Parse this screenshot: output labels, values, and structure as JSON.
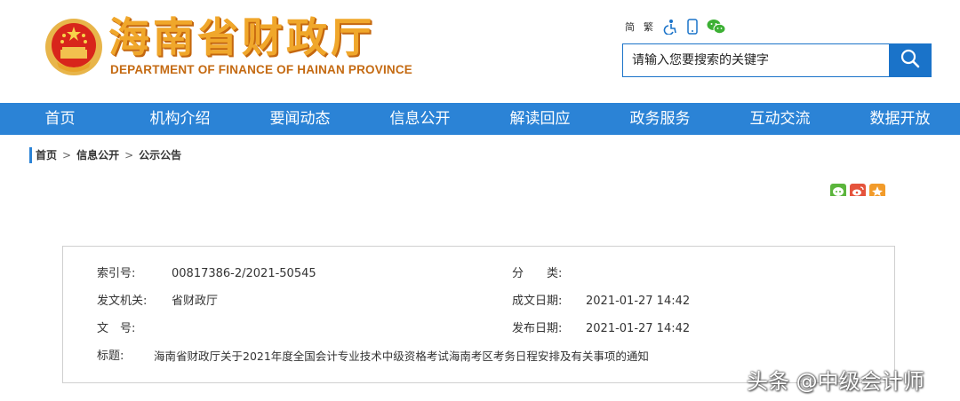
{
  "header": {
    "logo_cn": "海南省财政厅",
    "logo_en": "DEPARTMENT OF FINANCE OF HAINAN PROVINCE",
    "emblem_icon": "national-emblem-icon",
    "tools": {
      "simplified": "简",
      "traditional": "繁",
      "accessibility_icon": "accessibility-icon",
      "mobile_icon": "mobile-phone-icon",
      "wechat_icon": "wechat-icon"
    },
    "search": {
      "placeholder": "请输入您要搜索的关键字",
      "button_icon": "search-icon"
    }
  },
  "nav": {
    "items": [
      {
        "label": "首页"
      },
      {
        "label": "机构介绍"
      },
      {
        "label": "要闻动态"
      },
      {
        "label": "信息公开"
      },
      {
        "label": "解读回应"
      },
      {
        "label": "政务服务"
      },
      {
        "label": "互动交流"
      },
      {
        "label": "数据开放"
      }
    ]
  },
  "breadcrumb": {
    "items": [
      "首页",
      "信息公开",
      "公示公告"
    ],
    "separator": ">"
  },
  "share": {
    "icons": [
      "wechat-share-icon",
      "weibo-share-icon",
      "favorite-share-icon"
    ]
  },
  "meta": {
    "index_label": "索引号:",
    "index_value": "00817386-2/2021-50545",
    "category_label": "分　　类:",
    "category_value": "",
    "issuer_label": "发文机关:",
    "issuer_value": "省财政厅",
    "created_label": "成文日期:",
    "created_value": "2021-01-27 14:42",
    "docno_label": "文　号:",
    "docno_value": "",
    "published_label": "发布日期:",
    "published_value": "2021-01-27 14:42",
    "title_label": "标题:",
    "title_value": "海南省财政厅关于2021年度全国会计专业技术中级资格考试海南考区考务日程安排及有关事项的通知"
  },
  "watermark": "头条 @中级会计师",
  "colors": {
    "nav_blue": "#2b83d6",
    "logo_orange": "#f0a72b",
    "search_blue": "#1a73c9"
  }
}
